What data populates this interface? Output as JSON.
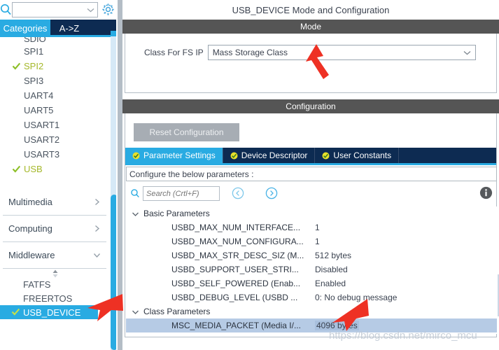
{
  "colors": {
    "accent_blue": "#29abe2",
    "navy": "#0d2b52",
    "section_gray": "#555555",
    "enabled_green": "#a5b82a",
    "arrow_red": "#ee3124",
    "selected_row": "#b6cbe5"
  },
  "left_panel": {
    "search": {
      "placeholder": "",
      "value": "",
      "icon": "search-icon"
    },
    "gear_icon": "gear-icon",
    "tabs": [
      {
        "label": "Categories",
        "active": true
      },
      {
        "label": "A->Z",
        "active": false
      }
    ],
    "peripherals": [
      {
        "label": "SDIO",
        "enabled": false,
        "clipped": true
      },
      {
        "label": "SPI1",
        "enabled": false
      },
      {
        "label": "SPI2",
        "enabled": true
      },
      {
        "label": "SPI3",
        "enabled": false
      },
      {
        "label": "UART4",
        "enabled": false
      },
      {
        "label": "UART5",
        "enabled": false
      },
      {
        "label": "USART1",
        "enabled": false
      },
      {
        "label": "USART2",
        "enabled": false
      },
      {
        "label": "USART3",
        "enabled": false
      },
      {
        "label": "USB",
        "enabled": true
      }
    ],
    "groups": [
      {
        "label": "Multimedia",
        "expanded": false,
        "chevron": "chevron-right-icon"
      },
      {
        "label": "Computing",
        "expanded": false,
        "chevron": "chevron-right-icon"
      },
      {
        "label": "Middleware",
        "expanded": true,
        "chevron": "chevron-down-icon"
      }
    ],
    "middleware_items": [
      {
        "label": "FATFS",
        "enabled": false,
        "selected": false
      },
      {
        "label": "FREERTOS",
        "enabled": false,
        "selected": false
      },
      {
        "label": "USB_DEVICE",
        "enabled": true,
        "selected": true
      }
    ],
    "scroll_glyph": "scroll-updown-icon"
  },
  "right_panel": {
    "title": "USB_DEVICE Mode and Configuration",
    "mode": {
      "section_label": "Mode",
      "class_label": "Class For FS IP",
      "class_value": "Mass Storage Class",
      "dropdown_icon": "chevron-down-icon"
    },
    "configuration": {
      "section_label": "Configuration",
      "reset_label": "Reset Configuration",
      "tabs": [
        {
          "label": "Parameter Settings",
          "active": true,
          "badge": "check-badge-icon"
        },
        {
          "label": "Device Descriptor",
          "active": false,
          "badge": "check-badge-icon"
        },
        {
          "label": "User Constants",
          "active": false,
          "badge": "check-badge-icon"
        }
      ],
      "note": "Configure the below parameters :",
      "search_placeholder": "Search (Crtl+F)",
      "search_value": "",
      "search_icon": "search-icon",
      "nav_back_icon": "circle-left-arrow-icon",
      "nav_forward_icon": "circle-right-arrow-icon",
      "info_icon": "info-icon",
      "tree": [
        {
          "type": "group",
          "label": "Basic Parameters",
          "expanded": true
        },
        {
          "type": "leaf",
          "name": "USBD_MAX_NUM_INTERFACE...",
          "value": "1",
          "selected": false
        },
        {
          "type": "leaf",
          "name": "USBD_MAX_NUM_CONFIGURA...",
          "value": "1",
          "selected": false
        },
        {
          "type": "leaf",
          "name": "USBD_MAX_STR_DESC_SIZ (M...",
          "value": "512 bytes",
          "selected": false
        },
        {
          "type": "leaf",
          "name": "USBD_SUPPORT_USER_STRI...",
          "value": "Disabled",
          "selected": false
        },
        {
          "type": "leaf",
          "name": "USBD_SELF_POWERED (Enab...",
          "value": "Enabled",
          "selected": false
        },
        {
          "type": "leaf",
          "name": "USBD_DEBUG_LEVEL (USBD ...",
          "value": "0: No debug message",
          "selected": false
        },
        {
          "type": "group",
          "label": "Class Parameters",
          "expanded": true
        },
        {
          "type": "leaf",
          "name": "MSC_MEDIA_PACKET (Media I/...",
          "value": "4096 bytes",
          "selected": true
        }
      ]
    }
  },
  "annotations": {
    "arrows": [
      {
        "name": "arrow-to-class-dropdown",
        "points_at": "Mass Storage Class dropdown"
      },
      {
        "name": "arrow-to-usb-device",
        "points_at": "USB_DEVICE middleware item"
      },
      {
        "name": "arrow-to-msc-media-packet",
        "points_at": "MSC_MEDIA_PACKET value"
      }
    ]
  },
  "watermark": "https://blog.csdn.net/mirco_mcu"
}
